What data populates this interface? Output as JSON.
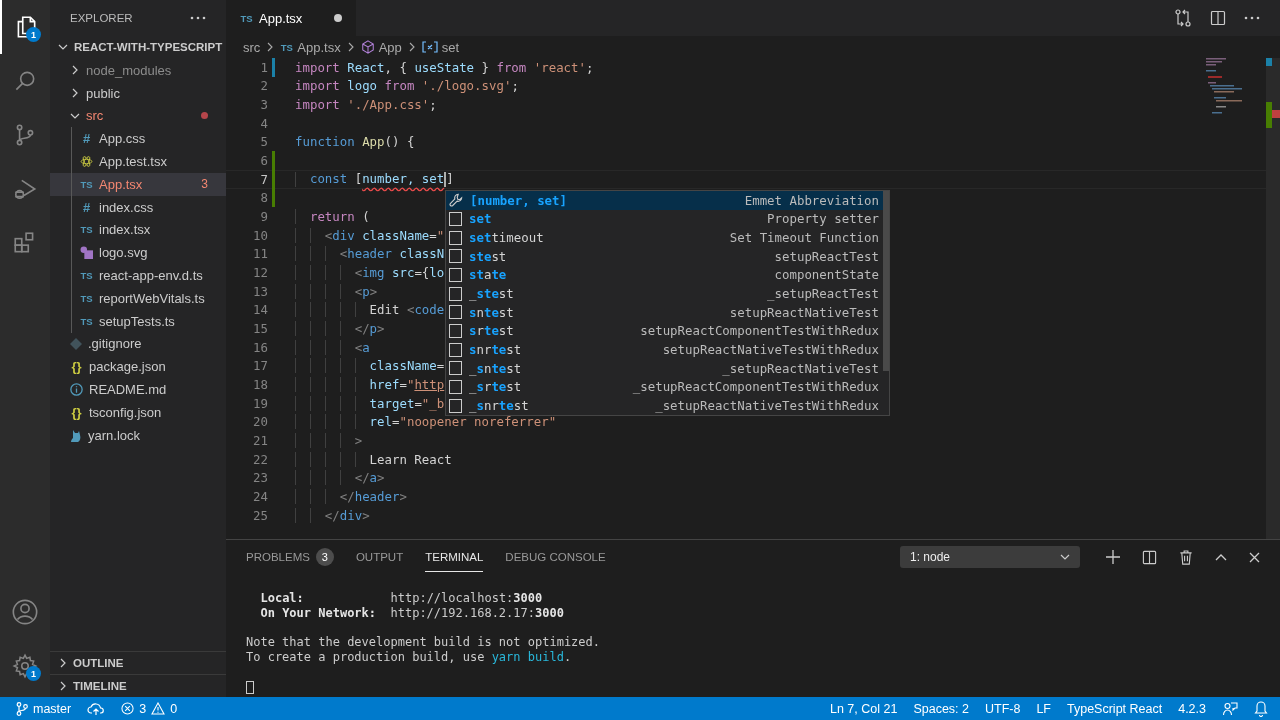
{
  "activity_bar": {
    "items": [
      {
        "kind": "files",
        "selected": true,
        "badge": "1"
      },
      {
        "kind": "search",
        "selected": false
      },
      {
        "kind": "source-control",
        "selected": false
      },
      {
        "kind": "run-debug",
        "selected": false
      },
      {
        "kind": "extensions",
        "selected": false
      }
    ],
    "bottom": [
      {
        "kind": "account"
      },
      {
        "kind": "settings",
        "badge": "1"
      }
    ]
  },
  "sidebar": {
    "title": "EXPLORER",
    "project": {
      "name": "REACT-WITH-TYPESCRIPT",
      "expanded": true
    },
    "tree": [
      {
        "name": "node_modules",
        "kind": "folder",
        "expanded": false,
        "ignored": true,
        "error": false,
        "selected": false
      },
      {
        "name": "public",
        "kind": "folder",
        "expanded": false,
        "ignored": false,
        "error": false,
        "selected": false
      },
      {
        "name": "src",
        "kind": "folder",
        "expanded": true,
        "ignored": false,
        "error": true,
        "selected": false,
        "children": [
          {
            "name": "App.css",
            "kind": "css",
            "glyph": "#",
            "ignored": false,
            "error": false,
            "selected": false
          },
          {
            "name": "App.test.tsx",
            "kind": "react",
            "ignored": false,
            "error": false,
            "selected": false
          },
          {
            "name": "App.tsx",
            "kind": "ts",
            "glyph": "TS",
            "ignored": false,
            "error": true,
            "selected": true,
            "badge": "3"
          },
          {
            "name": "index.css",
            "kind": "css",
            "glyph": "#",
            "ignored": false,
            "error": false,
            "selected": false
          },
          {
            "name": "index.tsx",
            "kind": "ts",
            "glyph": "TS",
            "ignored": false,
            "error": false,
            "selected": false
          },
          {
            "name": "logo.svg",
            "kind": "svg",
            "ignored": false,
            "error": false,
            "selected": false
          },
          {
            "name": "react-app-env.d.ts",
            "kind": "ts",
            "glyph": "TS",
            "ignored": false,
            "error": false,
            "selected": false
          },
          {
            "name": "reportWebVitals.ts",
            "kind": "ts",
            "glyph": "TS",
            "ignored": false,
            "error": false,
            "selected": false
          },
          {
            "name": "setupTests.ts",
            "kind": "ts",
            "glyph": "TS",
            "ignored": false,
            "error": false,
            "selected": false
          }
        ]
      },
      {
        "name": ".gitignore",
        "kind": "git",
        "ignored": false,
        "error": false,
        "selected": false
      },
      {
        "name": "package.json",
        "kind": "json",
        "glyph": "{}",
        "ignored": false,
        "error": false,
        "selected": false
      },
      {
        "name": "README.md",
        "kind": "info",
        "ignored": false,
        "error": false,
        "selected": false
      },
      {
        "name": "tsconfig.json",
        "kind": "json",
        "glyph": "{}",
        "ignored": false,
        "error": false,
        "selected": false
      },
      {
        "name": "yarn.lock",
        "kind": "yarn",
        "ignored": false,
        "error": false,
        "selected": false
      }
    ],
    "sections": [
      {
        "title": "OUTLINE",
        "expanded": false
      },
      {
        "title": "TIMELINE",
        "expanded": false
      }
    ]
  },
  "editor": {
    "tabs": [
      {
        "label": "App.tsx",
        "glyph": "TS",
        "selected": true,
        "modified": true
      }
    ],
    "breadcrumbs": [
      {
        "text": "src",
        "kind": "folder"
      },
      {
        "text": "App.tsx",
        "kind": "file",
        "glyph": "TS"
      },
      {
        "text": "App",
        "kind": "function"
      },
      {
        "text": "set",
        "kind": "variable"
      }
    ],
    "lines": [
      {
        "number": "1",
        "modified": true,
        "added": false,
        "current": false,
        "tokens": [
          {
            "kind": "keyword",
            "s": "import"
          },
          {
            "kind": "variable",
            "s": " React"
          },
          {
            "kind": "plain",
            "s": ", { "
          },
          {
            "kind": "variable",
            "s": "useState"
          },
          {
            "kind": "plain",
            "s": " } "
          },
          {
            "kind": "keyword",
            "s": "from"
          },
          {
            "kind": "string",
            "s": " 'react'"
          },
          {
            "kind": "plain",
            "s": ";"
          }
        ]
      },
      {
        "number": "2",
        "modified": false,
        "added": false,
        "current": false,
        "tokens": [
          {
            "kind": "keyword",
            "s": "import"
          },
          {
            "kind": "variable",
            "s": " logo"
          },
          {
            "kind": "keyword",
            "s": " from"
          },
          {
            "kind": "string",
            "s": " './logo.svg'"
          },
          {
            "kind": "plain",
            "s": ";"
          }
        ]
      },
      {
        "number": "3",
        "modified": false,
        "added": false,
        "current": false,
        "tokens": [
          {
            "kind": "keyword",
            "s": "import"
          },
          {
            "kind": "string",
            "s": " './App.css'"
          },
          {
            "kind": "plain",
            "s": ";"
          }
        ]
      },
      {
        "number": "4",
        "modified": false,
        "added": false,
        "current": false
      },
      {
        "number": "5",
        "modified": false,
        "added": false,
        "current": false,
        "tokens": [
          {
            "kind": "storage",
            "s": "function"
          },
          {
            "kind": "function",
            "s": " App"
          },
          {
            "kind": "plain",
            "s": "() {"
          }
        ]
      },
      {
        "number": "6",
        "modified": false,
        "added": true,
        "current": false
      },
      {
        "number": "7",
        "modified": false,
        "added": true,
        "current": true,
        "tokens": [
          {
            "kind": "storage",
            "s": "  const"
          },
          {
            "kind": "plain",
            "s": " ["
          },
          {
            "kind": "error",
            "s": "number, set"
          },
          {
            "kind": "cursor"
          },
          {
            "kind": "plain",
            "s": "]"
          }
        ]
      },
      {
        "number": "8",
        "modified": false,
        "added": true,
        "current": false
      },
      {
        "number": "9",
        "modified": false,
        "added": false,
        "current": false,
        "tokens": [
          {
            "kind": "keyword",
            "s": "  return"
          },
          {
            "kind": "plain",
            "s": " ("
          }
        ]
      },
      {
        "number": "10",
        "modified": false,
        "added": false,
        "current": false,
        "tokens": [
          {
            "kind": "punctuation",
            "s": "    <"
          },
          {
            "kind": "tag",
            "s": "div"
          },
          {
            "kind": "attribute",
            "s": " className"
          },
          {
            "kind": "plain",
            "s": "="
          },
          {
            "kind": "string",
            "s": "\""
          }
        ]
      },
      {
        "number": "11",
        "modified": false,
        "added": false,
        "current": false,
        "tokens": [
          {
            "kind": "punctuation",
            "s": "      <"
          },
          {
            "kind": "tag",
            "s": "header"
          },
          {
            "kind": "attribute",
            "s": " classN"
          }
        ]
      },
      {
        "number": "12",
        "modified": false,
        "added": false,
        "current": false,
        "tokens": [
          {
            "kind": "punctuation",
            "s": "        <"
          },
          {
            "kind": "tag",
            "s": "img"
          },
          {
            "kind": "attribute",
            "s": " src"
          },
          {
            "kind": "plain",
            "s": "={"
          },
          {
            "kind": "variable",
            "s": "lo"
          }
        ]
      },
      {
        "number": "13",
        "modified": false,
        "added": false,
        "current": false,
        "tokens": [
          {
            "kind": "punctuation",
            "s": "        <"
          },
          {
            "kind": "tag",
            "s": "p"
          },
          {
            "kind": "punctuation",
            "s": ">"
          }
        ]
      },
      {
        "number": "14",
        "modified": false,
        "added": false,
        "current": false,
        "tokens": [
          {
            "kind": "plain",
            "s": "          Edit "
          },
          {
            "kind": "punctuation",
            "s": "<"
          },
          {
            "kind": "tag",
            "s": "code"
          }
        ]
      },
      {
        "number": "15",
        "modified": false,
        "added": false,
        "current": false,
        "tokens": [
          {
            "kind": "punctuation",
            "s": "        </"
          },
          {
            "kind": "tag",
            "s": "p"
          },
          {
            "kind": "punctuation",
            "s": ">"
          }
        ]
      },
      {
        "number": "16",
        "modified": false,
        "added": false,
        "current": false,
        "tokens": [
          {
            "kind": "punctuation",
            "s": "        <"
          },
          {
            "kind": "tag",
            "s": "a"
          }
        ]
      },
      {
        "number": "17",
        "modified": false,
        "added": false,
        "current": false,
        "tokens": [
          {
            "kind": "attribute",
            "s": "          className"
          },
          {
            "kind": "plain",
            "s": "="
          }
        ]
      },
      {
        "number": "18",
        "modified": false,
        "added": false,
        "current": false,
        "tokens": [
          {
            "kind": "attribute",
            "s": "          href"
          },
          {
            "kind": "plain",
            "s": "="
          },
          {
            "kind": "string",
            "s": "\""
          },
          {
            "kind": "link",
            "s": "http"
          }
        ]
      },
      {
        "number": "19",
        "modified": false,
        "added": false,
        "current": false,
        "tokens": [
          {
            "kind": "attribute",
            "s": "          target"
          },
          {
            "kind": "plain",
            "s": "="
          },
          {
            "kind": "string",
            "s": "\"_b"
          }
        ]
      },
      {
        "number": "20",
        "modified": false,
        "added": false,
        "current": false,
        "tokens": [
          {
            "kind": "attribute",
            "s": "          rel"
          },
          {
            "kind": "plain",
            "s": "="
          },
          {
            "kind": "string",
            "s": "\"noopener noreferrer\""
          }
        ]
      },
      {
        "number": "21",
        "modified": false,
        "added": false,
        "current": false,
        "tokens": [
          {
            "kind": "punctuation",
            "s": "        >"
          }
        ]
      },
      {
        "number": "22",
        "modified": false,
        "added": false,
        "current": false,
        "tokens": [
          {
            "kind": "plain",
            "s": "          Learn React"
          }
        ]
      },
      {
        "number": "23",
        "modified": false,
        "added": false,
        "current": false,
        "tokens": [
          {
            "kind": "punctuation",
            "s": "        </"
          },
          {
            "kind": "tag",
            "s": "a"
          },
          {
            "kind": "punctuation",
            "s": ">"
          }
        ]
      },
      {
        "number": "24",
        "modified": false,
        "added": false,
        "current": false,
        "tokens": [
          {
            "kind": "punctuation",
            "s": "      </"
          },
          {
            "kind": "tag",
            "s": "header"
          },
          {
            "kind": "punctuation",
            "s": ">"
          }
        ]
      },
      {
        "number": "25",
        "modified": false,
        "added": false,
        "current": false,
        "tokens": [
          {
            "kind": "punctuation",
            "s": "    </"
          },
          {
            "kind": "tag",
            "s": "div"
          },
          {
            "kind": "punctuation",
            "s": ">"
          }
        ]
      }
    ],
    "suggestions": [
      {
        "kind": "snippet",
        "selected": true,
        "label": "**[number, set]**",
        "detail": "Emmet Abbreviation"
      },
      {
        "kind": "property",
        "selected": false,
        "label": "**set**",
        "detail": "Property setter"
      },
      {
        "kind": "property",
        "selected": false,
        "label": "**set**timeout",
        "detail": "Set Timeout Function"
      },
      {
        "kind": "property",
        "selected": false,
        "label": "**ste**st",
        "detail": "setupReactTest"
      },
      {
        "kind": "property",
        "selected": false,
        "label": "**st**a**te**",
        "detail": "componentState"
      },
      {
        "kind": "property",
        "selected": false,
        "label": "_**ste**st",
        "detail": "_setupReactTest"
      },
      {
        "kind": "property",
        "selected": false,
        "label": "**s**n**te**st",
        "detail": "setupReactNativeTest"
      },
      {
        "kind": "property",
        "selected": false,
        "label": "**s**r**te**st",
        "detail": "setupReactComponentTestWithRedux"
      },
      {
        "kind": "property",
        "selected": false,
        "label": "**s**nr**te**st",
        "detail": "setupReactNativeTestWithRedux"
      },
      {
        "kind": "property",
        "selected": false,
        "label": "_**s**n**te**st",
        "detail": "_setupReactNativeTest"
      },
      {
        "kind": "property",
        "selected": false,
        "label": "_**s**r**te**st",
        "detail": "_setupReactComponentTestWithRedux"
      },
      {
        "kind": "property",
        "selected": false,
        "label": "_**s**nr**te**st",
        "detail": "_setupReactNativeTestWithRedux"
      }
    ]
  },
  "panel": {
    "tabs": [
      {
        "label": "PROBLEMS",
        "selected": false,
        "badge": "3"
      },
      {
        "label": "OUTPUT",
        "selected": false
      },
      {
        "label": "TERMINAL",
        "selected": true
      },
      {
        "label": "DEBUG CONSOLE",
        "selected": false
      }
    ],
    "terminal_select": "1: node",
    "terminal": {
      "paragraphs": [
        [
          {
            "text": "  **Local:**            http://localhost:**3000**"
          },
          {
            "text": "  **On Your Network:**  http://192.168.2.17:**3000**"
          }
        ],
        [
          {
            "text": "Note that the development build is not optimized."
          },
          {
            "text": "To create a production build, use ",
            "command": "yarn build",
            "after": "."
          }
        ]
      ],
      "cursor": true
    }
  },
  "status_bar": {
    "branch": "master",
    "errors": "3",
    "warnings": "0",
    "items": [
      "Ln 7, Col 21",
      "Spaces: 2",
      "UTF-8",
      "LF",
      "TypeScript React",
      "4.2.3"
    ]
  }
}
